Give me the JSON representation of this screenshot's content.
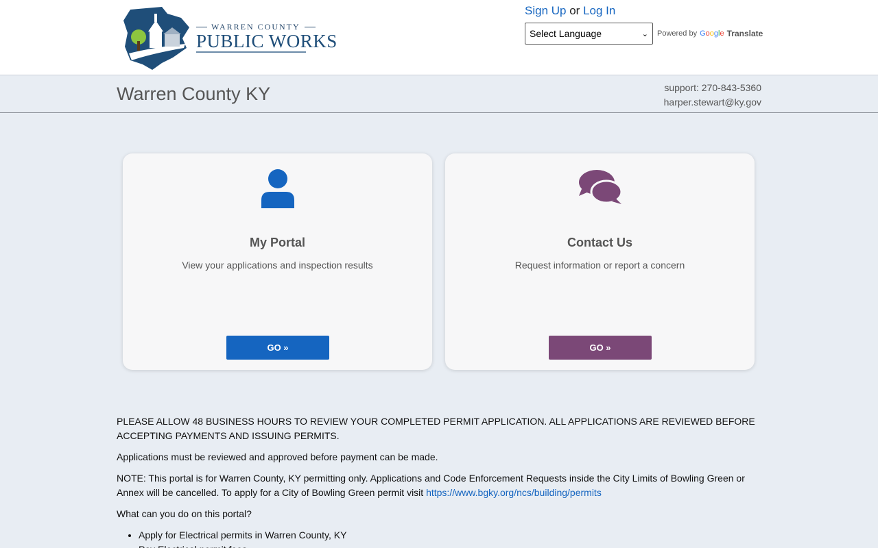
{
  "header": {
    "logo": {
      "line1": "WARREN COUNTY",
      "line2": "PUBLIC WORKS"
    },
    "auth": {
      "signup_label": "Sign Up",
      "or_text": "or",
      "login_label": "Log In"
    },
    "language_select": {
      "selected": "Select Language"
    },
    "powered_by": {
      "prefix": "Powered by",
      "google": "Google",
      "translate": "Translate"
    }
  },
  "subheader": {
    "title": "Warren County KY",
    "support_phone": "support: 270-843-5360",
    "support_email": "harper.stewart@ky.gov"
  },
  "cards": [
    {
      "icon": "user-icon",
      "title": "My Portal",
      "description": "View your applications and inspection results",
      "button_label": "GO »",
      "color": "#1565c0"
    },
    {
      "icon": "chat-bubbles-icon",
      "title": "Contact Us",
      "description": "Request information or report a concern",
      "button_label": "GO »",
      "color": "#7b4877"
    }
  ],
  "notes": {
    "notice": "PLEASE ALLOW 48 BUSINESS HOURS TO REVIEW YOUR COMPLETED PERMIT APPLICATION. ALL APPLICATIONS ARE REVIEWED BEFORE ACCEPTING PAYMENTS AND ISSUING PERMITS.",
    "review_note": "Applications must be reviewed and approved before payment can be made.",
    "portal_note": "NOTE: This portal is for Warren County, KY permitting only. Applications and Code Enforcement Requests inside the City Limits of Bowling Green or Annex will be cancelled. To apply for a City of Bowling Green permit visit",
    "portal_link": "https://www.bgky.org/ncs/building/permits",
    "question": "What can you do on this portal?",
    "items": [
      "Apply for Electrical permits in Warren County, KY",
      "Pay Electrical permit fees"
    ]
  },
  "colors": {
    "primary_blue": "#1565c0",
    "purple": "#7b4877",
    "page_bg": "#e8edf3"
  }
}
